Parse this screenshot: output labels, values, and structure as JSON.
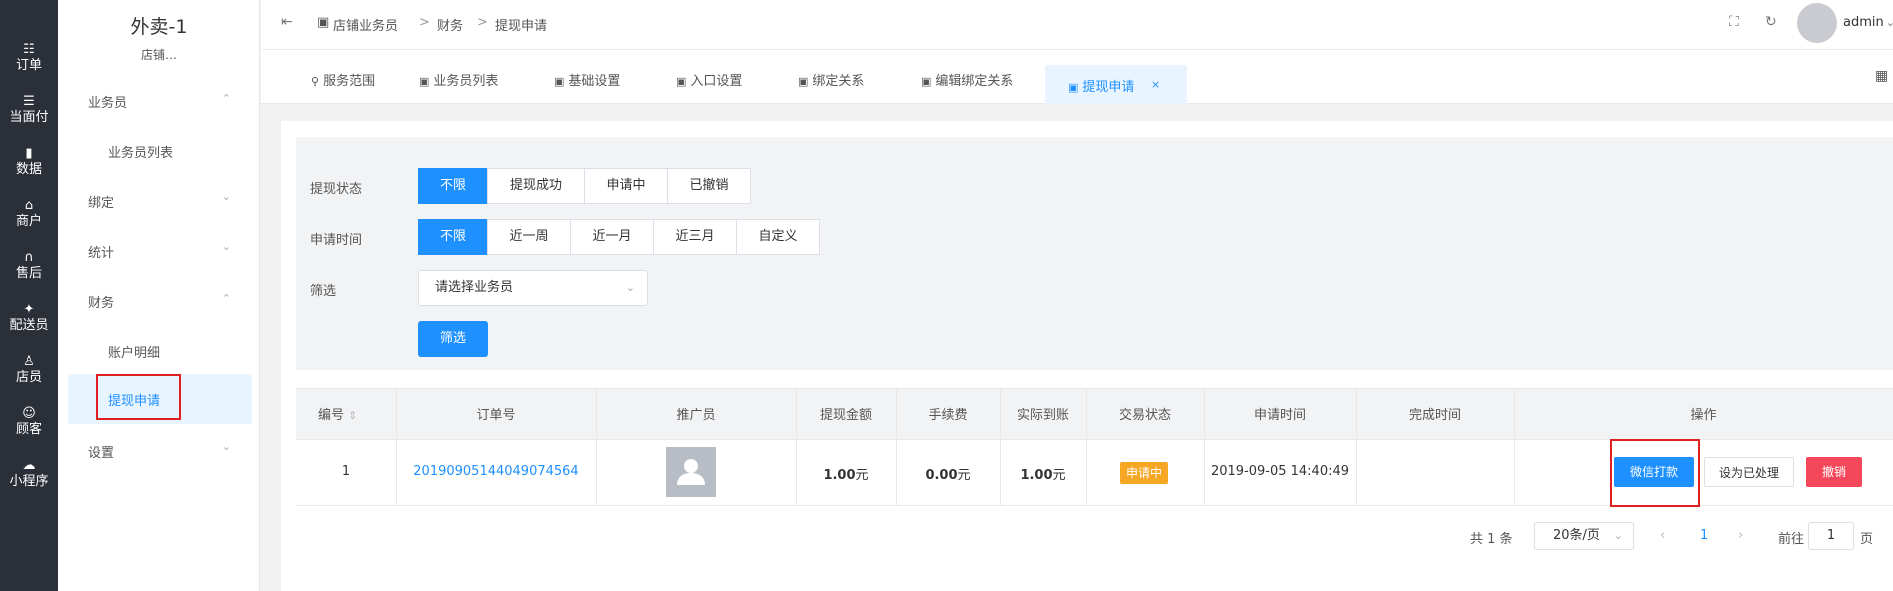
{
  "rail": [
    {
      "icon": "list-icon",
      "glyph": "☷",
      "label": "订单"
    },
    {
      "icon": "list-icon",
      "glyph": "☰",
      "label": "当面付"
    },
    {
      "icon": "bar-chart-icon",
      "glyph": "▮",
      "label": "数据"
    },
    {
      "icon": "shop-icon",
      "glyph": "⌂",
      "label": "商户"
    },
    {
      "icon": "headset-icon",
      "glyph": "∩",
      "label": "售后"
    },
    {
      "icon": "delivery-icon",
      "glyph": "✦",
      "label": "配送员"
    },
    {
      "icon": "person-icon",
      "glyph": "♙",
      "label": "店员"
    },
    {
      "icon": "customer-icon",
      "glyph": "☺",
      "label": "顾客"
    },
    {
      "icon": "wechat-icon",
      "glyph": "☁",
      "label": "小程序"
    }
  ],
  "sidebar": {
    "title": "外卖-1",
    "subtitle": "店铺…",
    "groups": [
      {
        "label": "业务员",
        "chev": "⌃"
      },
      {
        "label": "绑定",
        "chev": "⌄"
      },
      {
        "label": "统计",
        "chev": "⌄"
      },
      {
        "label": "财务",
        "chev": "⌃"
      },
      {
        "label": "设置",
        "chev": "⌄"
      }
    ],
    "sub_items": {
      "salesmen_list": "业务员列表",
      "account_detail": "账户明细",
      "withdraw": "提现申请"
    }
  },
  "header": {
    "collapse_glyph": "⇤",
    "breadcrumb": [
      "店铺业务员",
      ">",
      "财务",
      ">",
      "提现申请"
    ],
    "admin": "admin",
    "admin_chev": "⌄",
    "fullscreen_glyph": "⛶",
    "refresh_glyph": "↻"
  },
  "tabs": [
    {
      "icon": "⚲",
      "label": "服务范围"
    },
    {
      "icon": "▣",
      "label": "业务员列表"
    },
    {
      "icon": "▣",
      "label": "基础设置"
    },
    {
      "icon": "▣",
      "label": "入口设置"
    },
    {
      "icon": "▣",
      "label": "绑定关系"
    },
    {
      "icon": "▣",
      "label": "编辑绑定关系"
    },
    {
      "icon": "▣",
      "label": "提现申请",
      "close": "×"
    }
  ],
  "filters": {
    "status_label": "提现状态",
    "status_options": [
      "不限",
      "提现成功",
      "申请中",
      "已撤销"
    ],
    "time_label": "申请时间",
    "time_options": [
      "不限",
      "近一周",
      "近一月",
      "近三月",
      "自定义"
    ],
    "screen_label": "筛选",
    "select_placeholder": "请选择业务员",
    "select_chev": "⌄",
    "filter_button": "筛选"
  },
  "table": {
    "columns": [
      "编号",
      "订单号",
      "推广员",
      "提现金额",
      "手续费",
      "实际到账",
      "交易状态",
      "申请时间",
      "完成时间",
      "操作"
    ],
    "sort_glyph": "⇕",
    "row": {
      "id": "1",
      "order_no": "20190905144049074564",
      "amount": "1.00",
      "fee": "0.00",
      "actual": "1.00",
      "unit": "元",
      "status": "申请中",
      "apply_time": "2019-09-05 14:40:49",
      "finish_time": "",
      "actions": {
        "wechat_pay": "微信打款",
        "mark_done": "设为已处理",
        "revoke": "撤销"
      }
    }
  },
  "pagination": {
    "total": "共 1 条",
    "page_size": "20条/页",
    "page_size_chev": "⌄",
    "prev": "‹",
    "current": "1",
    "next": "›",
    "goto": "前往",
    "goto_value": "1",
    "page_suffix": "页"
  }
}
